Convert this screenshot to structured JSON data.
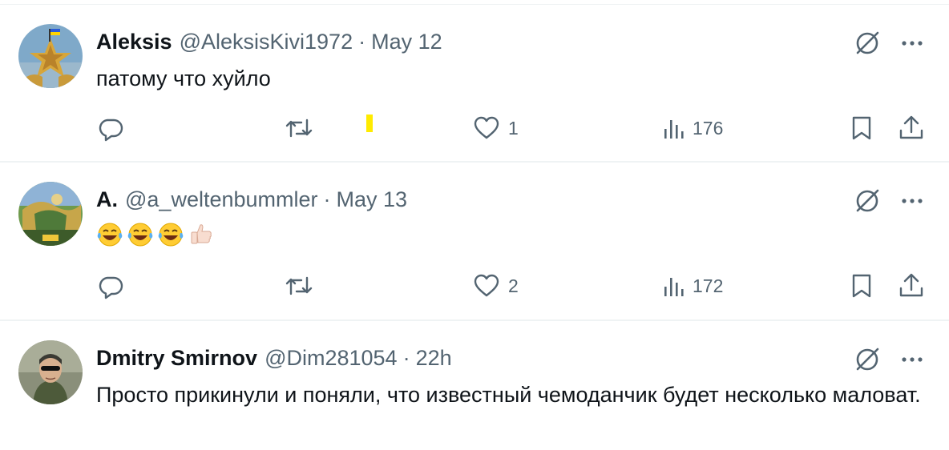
{
  "tweets": [
    {
      "name": "Aleksis",
      "handle": "@AleksisKivi1972",
      "separator": "·",
      "time": "May 12",
      "text": "патому что хуйло",
      "likes": "1",
      "views": "176"
    },
    {
      "name": "A.",
      "handle": "@a_weltenbummler",
      "separator": "·",
      "time": "May 13",
      "emojis": [
        "😂",
        "😂",
        "😂",
        "👍🏻"
      ],
      "likes": "2",
      "views": "172"
    },
    {
      "name": "Dmitry Smirnov",
      "handle": "@Dim281054",
      "separator": "·",
      "time": "22h",
      "text": "Просто прикинули и поняли, что известный чемоданчик будет несколько маловат."
    }
  ],
  "icons": {
    "grok": "grok-icon",
    "more": "more-icon",
    "reply": "reply-icon",
    "retweet": "retweet-icon",
    "like": "heart-icon",
    "views": "views-icon",
    "bookmark": "bookmark-icon",
    "share": "share-icon"
  },
  "colors": {
    "text": "#0f1419",
    "secondary": "#536471",
    "divider": "#eff3f4"
  }
}
